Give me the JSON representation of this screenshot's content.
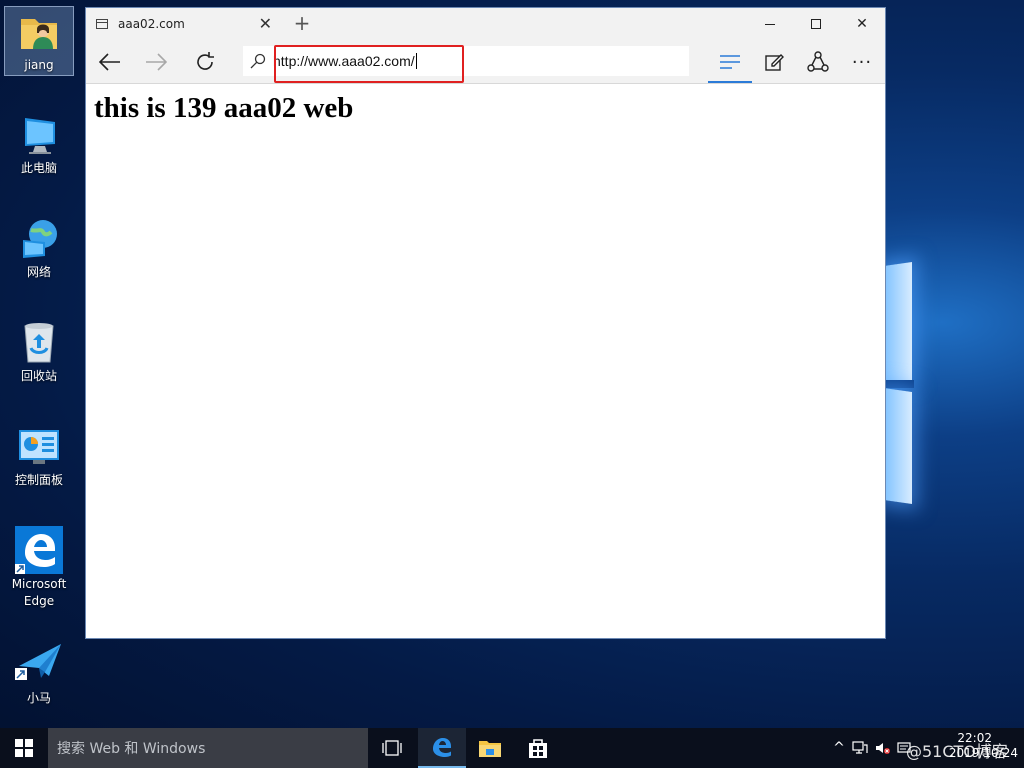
{
  "desktop": {
    "icons": [
      {
        "label": "jiang",
        "icon": "user-folder-icon"
      },
      {
        "label": "此电脑",
        "icon": "computer-icon"
      },
      {
        "label": "网络",
        "icon": "network-icon"
      },
      {
        "label": "回收站",
        "icon": "recycle-bin-icon"
      },
      {
        "label": "控制面板",
        "icon": "control-panel-icon"
      },
      {
        "label": "Microsoft Edge",
        "icon": "edge-icon"
      },
      {
        "label": "小马",
        "icon": "paper-plane-icon"
      }
    ]
  },
  "browser": {
    "tab_title": "aaa02.com",
    "new_tab": "+",
    "address": "http://www.aaa02.com/",
    "page_heading": "this is 139 aaa02 web"
  },
  "taskbar": {
    "search_placeholder": "搜索 Web 和 Windows",
    "time": "22:02",
    "date": "2019/10/24"
  },
  "watermark": "@51CTO博客",
  "colors": {
    "highlight": "#e02020",
    "edge_blue": "#0a78d7",
    "taskbar": "#0a0f1c"
  }
}
